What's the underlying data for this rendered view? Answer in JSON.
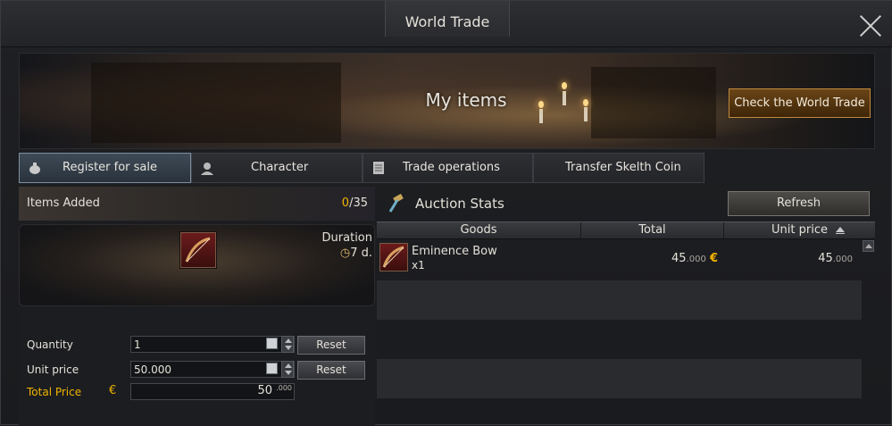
{
  "window": {
    "title": "World Trade"
  },
  "banner": {
    "title": "My items",
    "check_button": "Check the World Trade"
  },
  "tabs": [
    {
      "label": "Register for sale",
      "icon": "money-bag-icon",
      "active": true
    },
    {
      "label": "Character",
      "icon": "character-icon",
      "active": false
    },
    {
      "label": "Trade operations",
      "icon": "ledger-icon",
      "active": false
    },
    {
      "label": "Transfer Skelth Coin",
      "icon": "",
      "active": false
    }
  ],
  "left": {
    "items_added_label": "Items Added",
    "items_added_count": "0",
    "items_added_max": "/35",
    "duration_label": "Duration",
    "duration_value": "7 d.",
    "quantity_label": "Quantity",
    "quantity_value": "1",
    "unit_price_label": "Unit price",
    "unit_price_value": "50.000",
    "reset_label": "Reset",
    "total_price_label": "Total Price",
    "currency_symbol": "€",
    "total_price_value": "50",
    "total_price_decimals": ".000"
  },
  "auction": {
    "title": "Auction Stats",
    "refresh_label": "Refresh",
    "columns": [
      "Goods",
      "Total",
      "Unit price"
    ],
    "rows": [
      {
        "name": "Eminence Bow",
        "qty": "x1",
        "total_main": "45",
        "total_dec": ".000",
        "total_currency": "€",
        "unit_main": "45",
        "unit_dec": ".000"
      }
    ]
  },
  "colors": {
    "accent_gold": "#f0b400",
    "active_tab_border": "#7d90a3"
  }
}
